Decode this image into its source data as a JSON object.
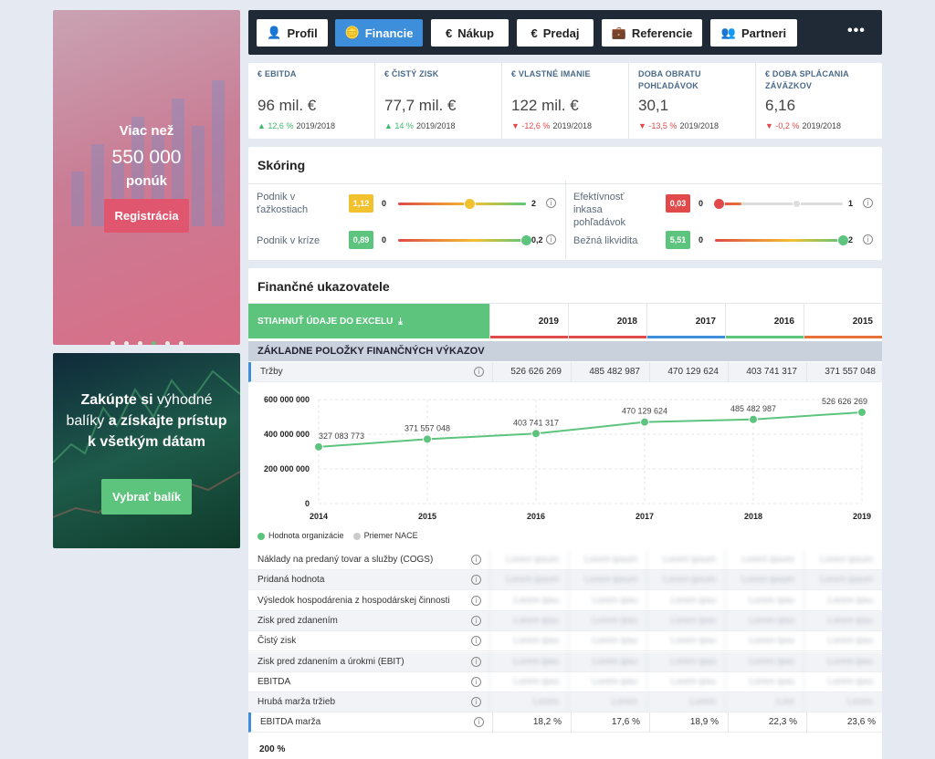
{
  "promo": {
    "line1": "Viac než",
    "line2": "550 000",
    "line3": "ponúk",
    "button": "Registrácia",
    "dots_total": 6,
    "dots_active": 4
  },
  "promo2": {
    "part1": "Zakúpte si",
    "part2": " výhodné balíky ",
    "part3": "a získajte prístup k všetkým dátam",
    "button": "Vybrať balík"
  },
  "nav": {
    "tabs": [
      {
        "label": "Profil",
        "icon": "user-icon"
      },
      {
        "label": "Financie",
        "icon": "coins-icon",
        "active": true
      },
      {
        "label": "Nákup",
        "icon": "euro-icon"
      },
      {
        "label": "Predaj",
        "icon": "euro-icon"
      },
      {
        "label": "Referencie",
        "icon": "briefcase-icon"
      },
      {
        "label": "Partneri",
        "icon": "users-icon"
      }
    ],
    "more": "•••"
  },
  "kpis": [
    {
      "label": "€ EBITDA",
      "value": "96 mil. €",
      "change": "12,6 %",
      "dir": "up",
      "period": "2019/2018"
    },
    {
      "label": "€ ČISTÝ ZISK",
      "value": "77,7 mil. €",
      "change": "14 %",
      "dir": "up",
      "period": "2019/2018"
    },
    {
      "label": "€ VLASTNÉ IMANIE",
      "value": "122 mil. €",
      "change": "-12,6 %",
      "dir": "down",
      "period": "2019/2018"
    },
    {
      "label": "DOBA OBRATU POHĽADÁVOK",
      "value": "30,1",
      "change": "-13,5 %",
      "dir": "down",
      "period": "2019/2018"
    },
    {
      "label": "€ DOBA SPLÁCANIA ZÁVÄZKOV",
      "value": "6,16",
      "change": "-0,2 %",
      "dir": "down",
      "period": "2019/2018"
    }
  ],
  "scoring": {
    "title": "Skóring",
    "items": [
      {
        "label": "Podnik v ťažkostiach",
        "badge": "1,12",
        "min": "0",
        "max": "2",
        "color": "#f2c12e",
        "level": 0.56
      },
      {
        "label": "Efektívnosť inkasa pohľadávok",
        "badge": "0,03",
        "min": "0",
        "max": "1",
        "color": "#e04a4a",
        "level": 0.03
      },
      {
        "label": "Podnik v kríze",
        "badge": "0,89",
        "min": "0",
        "max": "0,2",
        "color": "#5cc47c",
        "level": 1.0
      },
      {
        "label": "Bežná likvidita",
        "badge": "5,51",
        "min": "0",
        "max": "2",
        "color": "#5cc47c",
        "level": 1.0
      }
    ]
  },
  "fin": {
    "title": "Finančné ukazovatele",
    "download": "STIAHNUŤ ÚDAJE DO EXCELU",
    "years": [
      "2019",
      "2018",
      "2017",
      "2016",
      "2015"
    ],
    "year_colors": [
      "#e04a4a",
      "#e04a4a",
      "#3d8edb",
      "#5cc47c",
      "#e8703a"
    ],
    "section": "ZÁKLADNE POLOŽKY FINANČNÝCH VÝKAZOV",
    "trzby": {
      "label": "Tržby",
      "values": [
        "526 626 269",
        "485 482 987",
        "470 129 624",
        "403 741 317",
        "371 557 048"
      ]
    },
    "rows": [
      {
        "label": "Náklady na predaný tovar a služby (COGS)",
        "values": [
          "Lorem ipsum",
          "Lorem ipsum",
          "Lorem ipsum",
          "Lorem ipsum",
          "Lorem ipsum"
        ]
      },
      {
        "label": "Pridaná hodnota",
        "values": [
          "Lorem ipsum",
          "Lorem ipsum",
          "Lorem ipsum",
          "Lorem ipsum",
          "Lorem ipsum"
        ]
      },
      {
        "label": "Výsledok hospodárenia z hospodárskej činnosti",
        "values": [
          "Lorem ipsu",
          "Lorem ipsu",
          "Lorem ipsu",
          "Lorem ipsu",
          "Lorem ipsu"
        ]
      },
      {
        "label": "Zisk pred zdanením",
        "values": [
          "Lorem ipsu",
          "Lorem ipsu",
          "Lorem ipsu",
          "Lorem ipsu",
          "Lorem ipsu"
        ]
      },
      {
        "label": "Čistý zisk",
        "values": [
          "Lorem ipsu",
          "Lorem ipsu",
          "Lorem ipsu",
          "Lorem ipsu",
          "Lorem ipsu"
        ]
      },
      {
        "label": "Zisk pred zdanením a úrokmi (EBIT)",
        "values": [
          "Lorem ipsu",
          "Lorem ipsu",
          "Lorem ipsu",
          "Lorem ipsu",
          "Lorem ipsu"
        ]
      },
      {
        "label": "EBITDA",
        "values": [
          "Lorem ipsu",
          "Lorem ipsu",
          "Lorem ipsu",
          "Lorem ipsu",
          "Lorem ipsu"
        ]
      },
      {
        "label": "Hrubá marža tržieb",
        "values": [
          "Lorem",
          "Lorem",
          "Lorem",
          "Lore",
          "Lorem"
        ]
      }
    ],
    "ebitda_marza": {
      "label": "EBITDA marža",
      "values": [
        "18,2 %",
        "17,6 %",
        "18,9 %",
        "22,3 %",
        "23,6 %"
      ]
    },
    "next_chart_label": "200 %"
  },
  "chart_data": {
    "type": "line",
    "x": [
      "2014",
      "2015",
      "2016",
      "2017",
      "2018",
      "2019"
    ],
    "series": [
      {
        "name": "Hodnota organizácie",
        "values": [
          327083773,
          371557048,
          403741317,
          470129624,
          485482987,
          526626269
        ],
        "color": "#5cc47c"
      },
      {
        "name": "Priemer NACE",
        "values": [],
        "color": "#cccccc"
      }
    ],
    "data_labels": [
      "327 083 773",
      "371 557 048",
      "403 741 317",
      "470 129 624",
      "485 482 987",
      "526 626 269"
    ],
    "yticks": [
      "0",
      "200 000 000",
      "400 000 000",
      "600 000 000"
    ],
    "ylim": [
      0,
      600000000
    ],
    "legend_position": "bottom-left"
  }
}
